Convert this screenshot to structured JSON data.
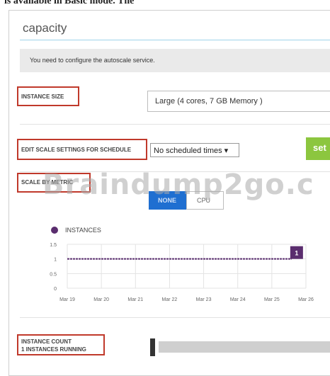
{
  "header_caption": "is available in Basic mode. The",
  "capacity": {
    "title": "capacity",
    "notice": "You need to configure the autoscale service."
  },
  "instance_size": {
    "label": "INSTANCE SIZE",
    "value": "Large (4 cores, 7 GB Memory )"
  },
  "schedule": {
    "label": "EDIT SCALE SETTINGS FOR SCHEDULE",
    "value": "No scheduled times ▾",
    "set_button": "set"
  },
  "scale_by_metric": {
    "label": "SCALE BY METRIC",
    "options": [
      "NONE",
      "CPU"
    ],
    "selected": "NONE"
  },
  "watermark": "Braindump2go.c",
  "chart_data": {
    "type": "line",
    "x": [
      "Mar 19",
      "Mar 20",
      "Mar 21",
      "Mar 22",
      "Mar 23",
      "Mar 24",
      "Mar 25",
      "Mar 26"
    ],
    "series": [
      {
        "name": "INSTANCES",
        "values": [
          1,
          1,
          1,
          1,
          1,
          1,
          1,
          null
        ],
        "color": "#5a2d6e"
      }
    ],
    "end_badge": "1",
    "ylim": [
      0,
      1.5
    ],
    "yticks": [
      "1.5",
      "1",
      "0.5",
      "0"
    ],
    "grid": true,
    "legend": "top-left"
  },
  "instance_count": {
    "line1": "INSTANCE COUNT",
    "line2": "1 INSTANCES RUNNING",
    "value": 1
  }
}
